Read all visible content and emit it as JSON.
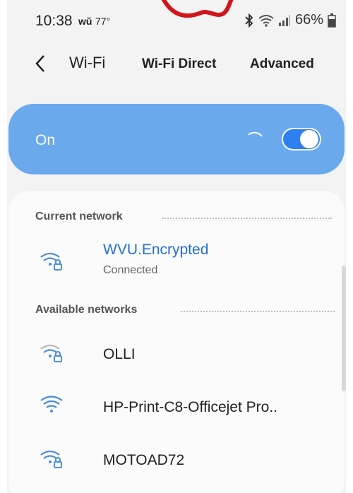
{
  "status_bar": {
    "time": "10:38",
    "weather_icon_text": "wǔ",
    "temperature": "77°",
    "battery": "66%",
    "icons": [
      "bluetooth-icon",
      "wifi-signal-icon",
      "cell-signal-icon",
      "battery-icon"
    ]
  },
  "header": {
    "title": "Wi-Fi",
    "wifi_direct": "Wi-Fi Direct",
    "advanced": "Advanced"
  },
  "master": {
    "label": "On",
    "enabled": true,
    "colors": {
      "card": "#6aa9ec",
      "toggle": "#2e7ff0"
    }
  },
  "current_network": {
    "section_label": "Current network",
    "name": "WVU.Encrypted",
    "status": "Connected",
    "secured": true,
    "name_color": "#1f6fd1"
  },
  "available_networks": {
    "section_label": "Available networks",
    "items": [
      {
        "name": "OLLI",
        "secured": true,
        "signal": "weak"
      },
      {
        "name": "HP-Print-C8-Officejet Pro..",
        "secured": false,
        "signal": "strong"
      },
      {
        "name": "MOTOAD72",
        "secured": true,
        "signal": "strong"
      }
    ]
  }
}
